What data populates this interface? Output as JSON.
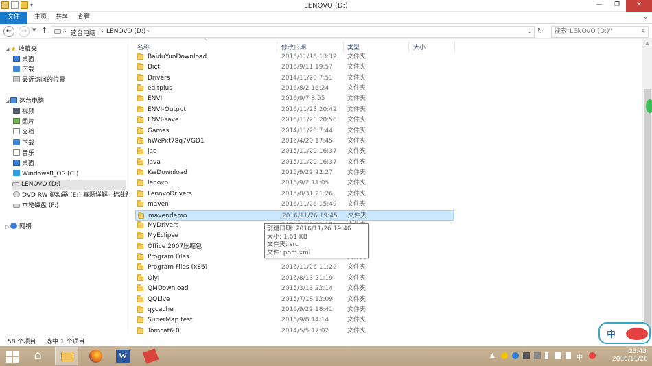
{
  "window": {
    "title": "LENOVO (D:)",
    "controls": {
      "minimize": "—",
      "maximize": "❐",
      "close": "✕"
    }
  },
  "ribbon": {
    "tabs": [
      "文件",
      "主页",
      "共享",
      "查看"
    ],
    "expand_icon": "chevron-down-icon"
  },
  "address": {
    "breadcrumb": [
      "这台电脑",
      "LENOVO (D:)"
    ],
    "separator": "›",
    "search_placeholder": "搜索\"LENOVO (D:)\""
  },
  "nav": {
    "favorites": {
      "label": "收藏夹",
      "items": [
        "桌面",
        "下载",
        "最近访问的位置"
      ]
    },
    "thispc": {
      "label": "这台电脑",
      "items": [
        "视频",
        "图片",
        "文档",
        "下载",
        "音乐",
        "桌面",
        "Windows8_OS (C:)",
        "LENOVO (D:)",
        "DVD RW 驱动器 (E:) 真题详解+标准预",
        "本地磁盘 (F:)"
      ]
    },
    "network": {
      "label": "网络"
    },
    "selected": "LENOVO (D:)"
  },
  "columns": {
    "name": "名称",
    "date": "修改日期",
    "type": "类型",
    "size": "大小"
  },
  "files": [
    {
      "name": "BaiduYunDownload",
      "date": "2016/11/16 13:32",
      "type": "文件夹"
    },
    {
      "name": "Dict",
      "date": "2016/9/11 19:57",
      "type": "文件夹"
    },
    {
      "name": "Drivers",
      "date": "2014/11/20 7:51",
      "type": "文件夹"
    },
    {
      "name": "editplus",
      "date": "2016/8/2 16:24",
      "type": "文件夹"
    },
    {
      "name": "ENVI",
      "date": "2016/9/7 8:55",
      "type": "文件夹"
    },
    {
      "name": "ENVI-Output",
      "date": "2016/11/23 20:42",
      "type": "文件夹"
    },
    {
      "name": "ENVI-save",
      "date": "2016/11/23 20:56",
      "type": "文件夹"
    },
    {
      "name": "Games",
      "date": "2014/11/20 7:44",
      "type": "文件夹"
    },
    {
      "name": "hWePxt78q7VGD1",
      "date": "2016/4/20 17:45",
      "type": "文件夹"
    },
    {
      "name": "jad",
      "date": "2015/11/29 16:37",
      "type": "文件夹"
    },
    {
      "name": "java",
      "date": "2015/11/29 16:37",
      "type": "文件夹"
    },
    {
      "name": "KwDownload",
      "date": "2015/9/22 22:27",
      "type": "文件夹"
    },
    {
      "name": "lenovo",
      "date": "2016/9/2 11:05",
      "type": "文件夹"
    },
    {
      "name": "LenovoDrivers",
      "date": "2015/8/31 21:26",
      "type": "文件夹"
    },
    {
      "name": "maven",
      "date": "2016/11/26 15:49",
      "type": "文件夹"
    },
    {
      "name": "mavendemo",
      "date": "2016/11/26 19:45",
      "type": "文件夹"
    },
    {
      "name": "MyDrivers",
      "date": "2016/9/29 22:17",
      "type": "文件夹"
    },
    {
      "name": "MyEclipse",
      "date": "",
      "type": "文件夹"
    },
    {
      "name": "Office 2007压缩包",
      "date": "",
      "type": "文件夹"
    },
    {
      "name": "Program Files",
      "date": "",
      "type": "文件夹"
    },
    {
      "name": "Program Files (x86)",
      "date": "2016/11/26 11:22",
      "type": "文件夹"
    },
    {
      "name": "Qiyi",
      "date": "2016/8/13 21:19",
      "type": "文件夹"
    },
    {
      "name": "QMDownload",
      "date": "2015/3/13 22:14",
      "type": "文件夹"
    },
    {
      "name": "QQLive",
      "date": "2015/7/18 12:09",
      "type": "文件夹"
    },
    {
      "name": "qycache",
      "date": "2016/9/22 18:41",
      "type": "文件夹"
    },
    {
      "name": "SuperMap test",
      "date": "2016/9/8 14:14",
      "type": "文件夹"
    },
    {
      "name": "Tomcat6.0",
      "date": "2014/5/5 17:02",
      "type": "文件夹"
    }
  ],
  "selected_file": "mavendemo",
  "tooltip": {
    "created": "创建日期: 2016/11/26 19:46",
    "size": "大小: 1.61 KB",
    "folders": "文件夹: src",
    "files": "文件: pom.xml"
  },
  "status": {
    "count": "58 个项目",
    "selected": "选中 1 个项目"
  },
  "ime_badge": {
    "label": "中"
  },
  "taskbar": {
    "apps": [
      "start-icon",
      "ie-icon",
      "file-explorer-icon",
      "firefox-icon",
      "word-icon",
      "app-icon"
    ],
    "tray_ime": "中",
    "clock_time": "23:43",
    "clock_date": "2016/11/26"
  },
  "colors": {
    "accent": "#1979ca",
    "selection": "#cce8ff",
    "close": "#c7413a"
  }
}
